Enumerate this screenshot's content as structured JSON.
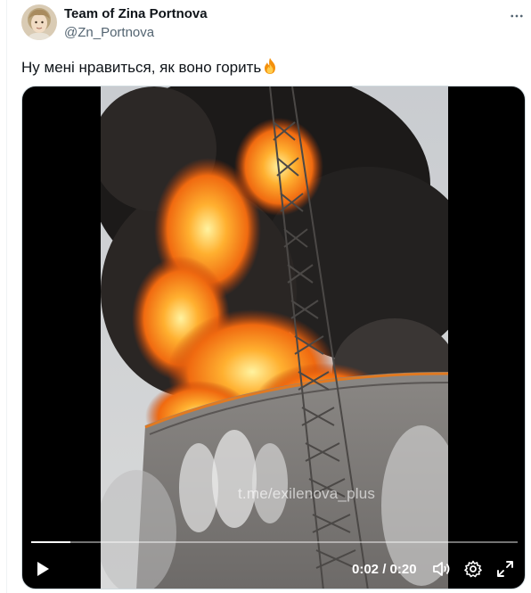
{
  "author": {
    "name": "Team of Zina Portnova",
    "handle": "@Zn_Portnova",
    "avatar_icon": "avatar-portrait"
  },
  "tweet": {
    "text": "Ну мені нравиться, як воно горить",
    "emoji_icon": "fire-emoji"
  },
  "video": {
    "watermark": "t.me/exilenova_plus",
    "current_time": "0:02",
    "duration": "0:20",
    "time_display": "0:02 / 0:20",
    "progress": 0.08,
    "controls": [
      "play-icon",
      "volume-icon",
      "settings-icon",
      "fullscreen-icon"
    ]
  },
  "colors": {
    "text_primary": "#0f1419",
    "text_secondary": "#536471",
    "video_bg": "#000000",
    "fire": "#f07a1a"
  }
}
